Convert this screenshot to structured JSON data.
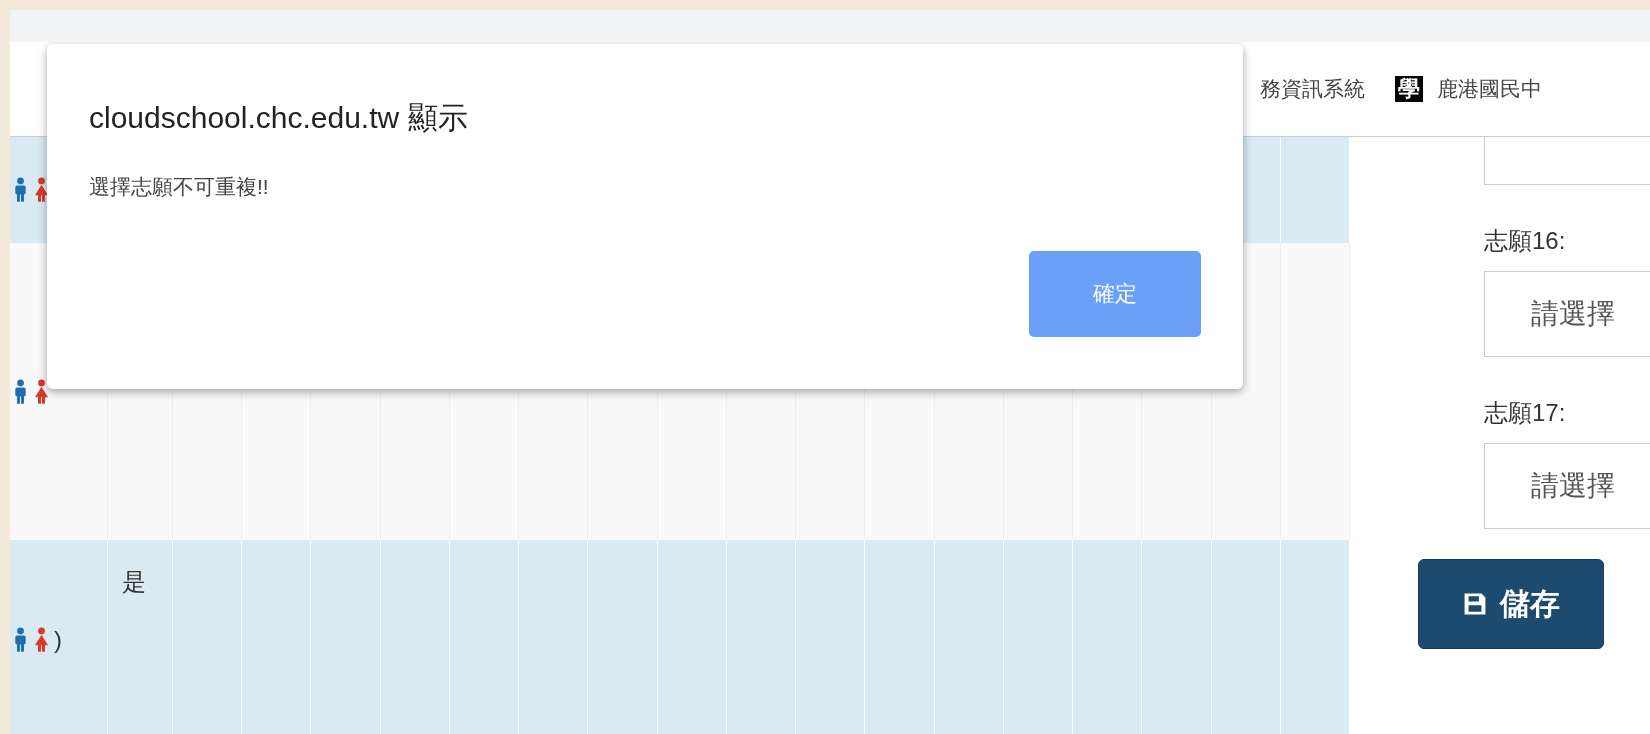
{
  "bookmarks_bar": {
    "items": [
      {
        "label": "務資訊系統"
      },
      {
        "label": "鹿港國民中",
        "icon_text": "學"
      }
    ]
  },
  "table": {
    "rows": [
      {
        "shaded": true
      },
      {
        "shaded": false
      },
      {
        "shaded": true,
        "answer": "是",
        "suffix": ")"
      }
    ]
  },
  "side_panel": {
    "selects": [
      {
        "label": "志願16:",
        "value": "請選擇"
      },
      {
        "label": "志願17:",
        "value": "請選擇"
      }
    ],
    "save_button": "儲存"
  },
  "dialog": {
    "title": "cloudschool.chc.edu.tw 顯示",
    "message": "選擇志願不可重複!!",
    "ok_button": "確定"
  }
}
